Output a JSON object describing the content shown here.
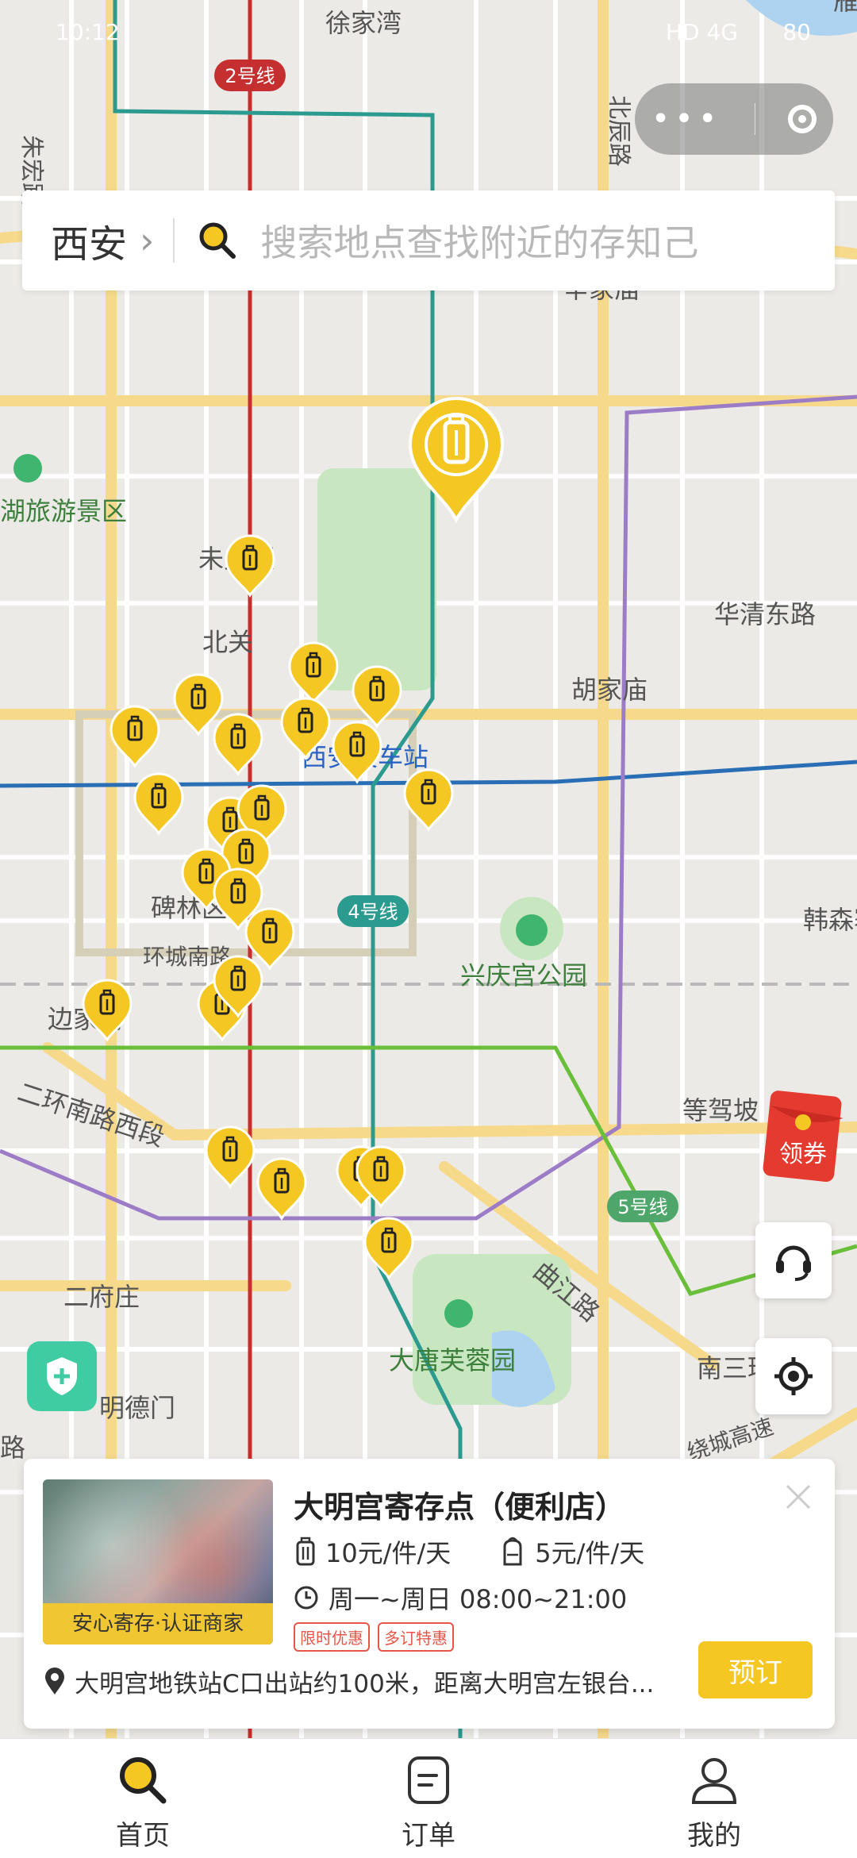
{
  "status_bar": {
    "time": "10:12",
    "network": "HD 4G",
    "battery": "80"
  },
  "search": {
    "city": "西安",
    "placeholder": "搜索地点查找附近的存知己"
  },
  "map": {
    "labels": {
      "xujiawan": "徐家湾",
      "zhuhong": "朱宏路",
      "beichen": "北辰路",
      "line2": "2号线",
      "line4": "4号线",
      "line5": "5号线",
      "xinjiamiao": "辛家庙",
      "weiyang": "未央区",
      "lake_scenic": "湖旅游景区",
      "beiguan": "北关",
      "huaqing_east": "华清东路",
      "hujiamiao": "胡家庙",
      "xian_station": "西安火车站",
      "beilin": "碑林区",
      "huancheng": "环城南路",
      "xingqing_park": "兴庆宫公园",
      "hansen": "韩森寨",
      "bianjiacun": "边家村",
      "erhuan_south": "二环南路西段",
      "dengjiapo": "等驾坡",
      "qujiang": "曲江路",
      "erfuzhuang": "二府庄",
      "datang_furong": "大唐芙蓉园",
      "mingdemen": "明德门",
      "nansan": "南三环",
      "raocheng": "绕城高速",
      "lu": "路",
      "ya": "雁"
    }
  },
  "coupon": {
    "label": "领券"
  },
  "card": {
    "title": "大明宫寄存点（便利店）",
    "badge": "安心寄存·认证商家",
    "price_luggage": "10元/件/天",
    "price_backpack": "5元/件/天",
    "hours": "周一~周日 08:00~21:00",
    "tags": [
      "限时优惠",
      "多订特惠"
    ],
    "address": "大明宫地铁站C口出站约100米，距离大明宫左银台...",
    "book_label": "预订"
  },
  "tabs": [
    {
      "label": "首页",
      "icon": "search-icon",
      "active": true
    },
    {
      "label": "订单",
      "icon": "order-icon",
      "active": false
    },
    {
      "label": "我的",
      "icon": "user-icon",
      "active": false
    }
  ],
  "colors": {
    "accent": "#f5c722",
    "line2": "#c62f2f",
    "line1": "#2a6fb5",
    "line4": "#2b9a8f",
    "line5": "#9c7cc7",
    "green_line": "#6abf3a",
    "park": "#c8e6c0"
  }
}
